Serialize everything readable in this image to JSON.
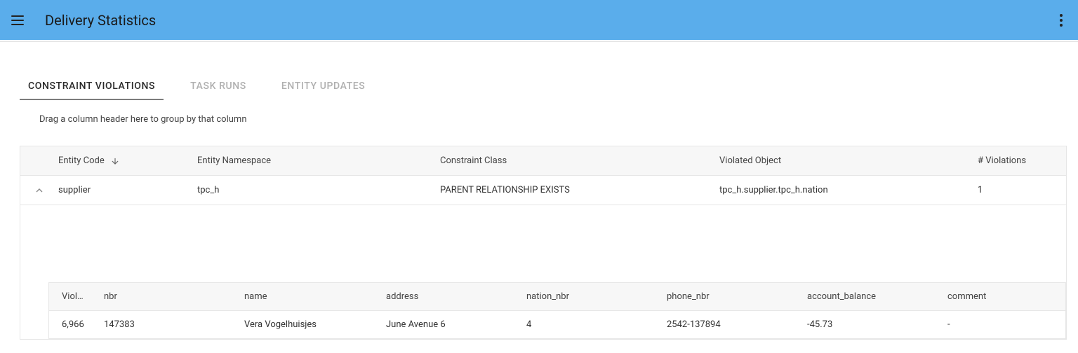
{
  "header": {
    "title": "Delivery Statistics"
  },
  "tabs": [
    {
      "label": "CONSTRAINT VIOLATIONS",
      "active": true
    },
    {
      "label": "TASK RUNS",
      "active": false
    },
    {
      "label": "ENTITY UPDATES",
      "active": false
    }
  ],
  "group_hint": "Drag a column header here to group by that column",
  "main_table": {
    "columns": {
      "entity_code": "Entity Code",
      "entity_namespace": "Entity Namespace",
      "constraint_class": "Constraint Class",
      "violated_object": "Violated Object",
      "violations_count": "# Violations"
    },
    "rows": [
      {
        "entity_code": "supplier",
        "entity_namespace": "tpc_h",
        "constraint_class": "PARENT RELATIONSHIP EXISTS",
        "violated_object": "tpc_h.supplier.tpc_h.nation",
        "violations_count": "1"
      }
    ]
  },
  "detail_table": {
    "columns": {
      "viol": "Viol…",
      "nbr": "nbr",
      "name": "name",
      "address": "address",
      "nation_nbr": "nation_nbr",
      "phone_nbr": "phone_nbr",
      "account_balance": "account_balance",
      "comment": "comment"
    },
    "rows": [
      {
        "viol": "6,966",
        "nbr": "147383",
        "name": "Vera Vogelhuisjes",
        "address": "June Avenue 6",
        "nation_nbr": "4",
        "phone_nbr": "2542-137894",
        "account_balance": "-45.73",
        "comment": "-"
      }
    ]
  }
}
